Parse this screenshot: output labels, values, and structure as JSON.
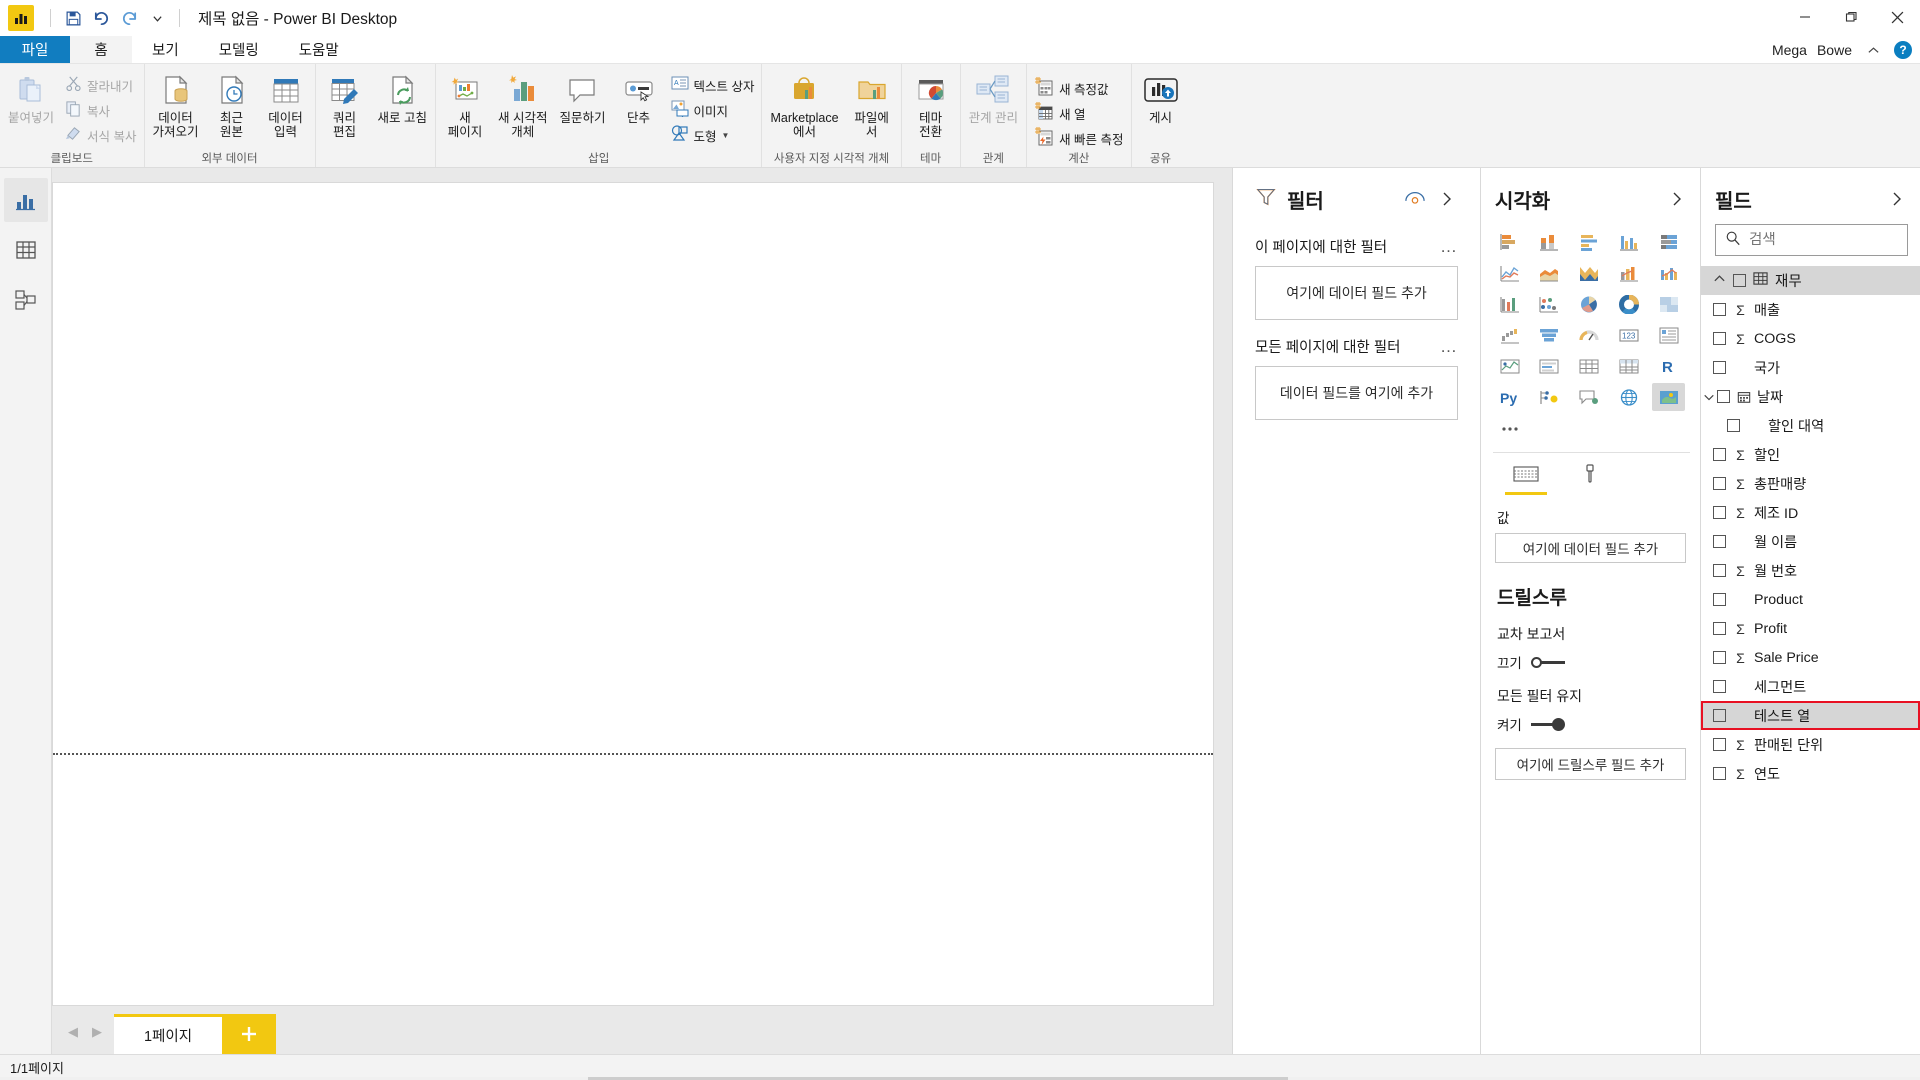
{
  "titlebar": {
    "logo_icon": "power-bi-logo",
    "save_icon": "save-icon",
    "undo_icon": "undo-icon",
    "redo_icon": "redo-icon",
    "qat_more_icon": "chevron-down-icon",
    "document_title": "제목 없음 - Power BI Desktop",
    "minimize_icon": "minimize-icon",
    "restore_icon": "restore-icon",
    "close_icon": "close-icon"
  },
  "tabs": [
    {
      "label": "파일",
      "kind": "file"
    },
    {
      "label": "홈",
      "kind": "active"
    },
    {
      "label": "보기",
      "kind": "normal"
    },
    {
      "label": "모델링",
      "kind": "normal"
    },
    {
      "label": "도움말",
      "kind": "normal"
    }
  ],
  "account": {
    "name_first": "Mega",
    "name_last": "Bowe",
    "collapse_icon": "chevron-up-icon",
    "help_label": "?"
  },
  "ribbon": {
    "groups": [
      {
        "label": "클립보드",
        "big": [
          {
            "label": "붙여넣기",
            "icon": "paste-icon",
            "disabled": true
          }
        ],
        "small": [
          {
            "label": "잘라내기",
            "icon": "cut-icon",
            "disabled": true
          },
          {
            "label": "복사",
            "icon": "copy-icon",
            "disabled": true
          },
          {
            "label": "서식 복사",
            "icon": "format-painter-icon",
            "disabled": true
          }
        ]
      },
      {
        "label": "외부 데이터",
        "big": [
          {
            "label": "데이터\n가져오기",
            "icon": "get-data-icon",
            "caret": true
          },
          {
            "label": "최근\n원본",
            "icon": "recent-sources-icon",
            "caret": true
          },
          {
            "label": "데이터\n입력",
            "icon": "enter-data-icon",
            "caret": false
          },
          {
            "label": "쿼리\n편집",
            "icon": "edit-queries-icon",
            "caret": true
          },
          {
            "label": "새로 고침",
            "icon": "refresh-icon",
            "caret": false
          }
        ]
      },
      {
        "label": "삽입",
        "big": [
          {
            "label": "새\n페이지",
            "icon": "new-page-icon",
            "caret": true
          },
          {
            "label": "새 시각적\n개체",
            "icon": "new-visual-icon",
            "caret": false
          },
          {
            "label": "질문하기",
            "icon": "ask-question-icon",
            "caret": false
          },
          {
            "label": "단추",
            "icon": "button-icon",
            "caret": true
          }
        ],
        "small": [
          {
            "label": "텍스트 상자",
            "icon": "text-box-icon",
            "disabled": false
          },
          {
            "label": "이미지",
            "icon": "image-icon",
            "disabled": false
          },
          {
            "label": "도형",
            "icon": "shapes-icon",
            "disabled": false,
            "caret": true
          }
        ]
      },
      {
        "label": "사용자 지정 시각적 개체",
        "big": [
          {
            "label": "Marketplace\n에서",
            "icon": "marketplace-icon",
            "caret": false
          },
          {
            "label": "파일에\n서",
            "icon": "from-file-icon",
            "caret": false
          }
        ]
      },
      {
        "label": "테마",
        "big": [
          {
            "label": "테마\n전환",
            "icon": "switch-theme-icon",
            "caret": true
          }
        ]
      },
      {
        "label": "관계",
        "big": [
          {
            "label": "관계 관리",
            "icon": "manage-relationships-icon",
            "disabled": true
          }
        ]
      },
      {
        "label": "계산",
        "small": [
          {
            "label": "새 측정값",
            "icon": "new-measure-icon"
          },
          {
            "label": "새 열",
            "icon": "new-column-icon"
          },
          {
            "label": "새 빠른 측정",
            "icon": "new-quick-measure-icon"
          }
        ]
      },
      {
        "label": "공유",
        "big": [
          {
            "label": "게시",
            "icon": "publish-icon",
            "caret": false
          }
        ]
      }
    ]
  },
  "viewbar": {
    "items": [
      {
        "name": "report-view",
        "icon": "report-view-icon",
        "active": true
      },
      {
        "name": "data-view",
        "icon": "data-view-icon",
        "active": false
      },
      {
        "name": "model-view",
        "icon": "model-view-icon",
        "active": false
      }
    ]
  },
  "filters": {
    "title": "필터",
    "eye_icon": "eye-icon",
    "expand_icon": "chevron-right-icon",
    "page_filter_label": "이 페이지에 대한 필터",
    "page_filter_dropzone": "여기에 데이터 필드 추가",
    "all_pages_filter_label": "모든 페이지에 대한 필터",
    "all_pages_dropzone": "데이터 필드를 여기에 추가",
    "more_icon": "ellipsis-icon"
  },
  "visualizations": {
    "title": "시각화",
    "expand_icon": "chevron-right-icon",
    "icons": [
      "stacked-bar-chart",
      "stacked-column-chart",
      "clustered-bar-chart",
      "clustered-column-chart",
      "100-stacked-bar-chart",
      "line-chart",
      "area-chart",
      "stacked-area-chart",
      "line-and-stacked-column-chart",
      "line-and-clustered-column-chart",
      "ribbon-chart",
      "scatter-chart",
      "pie-chart",
      "donut-chart",
      "treemap",
      "waterfall-chart",
      "funnel-chart",
      "gauge-chart",
      "card",
      "multi-row-card",
      "kpi",
      "slicer",
      "table",
      "matrix",
      "r-script-visual",
      "py-visual",
      "key-influencers",
      "qna-visual",
      "arcgis-map",
      "filled-map",
      "more-visuals"
    ],
    "selected_icon_index": 29,
    "fieldwell_tabs": [
      {
        "name": "fields-tab",
        "icon": "fields-well-icon",
        "active": true
      },
      {
        "name": "format-tab",
        "icon": "format-paintbrush-icon",
        "active": false
      }
    ],
    "values_label": "값",
    "values_dropzone": "여기에 데이터 필드 추가",
    "drillthrough_title": "드릴스루",
    "cross_report_label": "교차 보고서",
    "cross_report_toggle_label": "끄기",
    "cross_report_toggle_on": false,
    "keep_filters_label": "모든 필터 유지",
    "keep_filters_toggle_label": "켜기",
    "keep_filters_toggle_on": true,
    "drillthrough_dropzone": "여기에 드릴스루 필드 추가"
  },
  "fields": {
    "title": "필드",
    "expand_icon": "chevron-right-icon",
    "search_icon": "search-icon",
    "search_placeholder": "검색",
    "search_value": "",
    "table": {
      "name": "재무",
      "icon": "table-icon",
      "collapse_icon": "chevron-up-icon",
      "expanded": true
    },
    "items": [
      {
        "label": "매출",
        "sigma": true,
        "checked": false,
        "indent": false,
        "icon": null,
        "chevron": null,
        "highlighted": false
      },
      {
        "label": "COGS",
        "sigma": true,
        "checked": false,
        "indent": false,
        "icon": null,
        "chevron": null,
        "highlighted": false
      },
      {
        "label": "국가",
        "sigma": false,
        "checked": false,
        "indent": false,
        "icon": null,
        "chevron": null,
        "highlighted": false
      },
      {
        "label": "날짜",
        "sigma": false,
        "checked": false,
        "indent": false,
        "icon": "calendar-icon",
        "chevron": "chevron-down-icon",
        "highlighted": false
      },
      {
        "label": "할인 대역",
        "sigma": false,
        "checked": false,
        "indent": true,
        "icon": null,
        "chevron": null,
        "highlighted": false
      },
      {
        "label": "할인",
        "sigma": true,
        "checked": false,
        "indent": false,
        "icon": null,
        "chevron": null,
        "highlighted": false
      },
      {
        "label": "총판매량",
        "sigma": true,
        "checked": false,
        "indent": false,
        "icon": null,
        "chevron": null,
        "highlighted": false
      },
      {
        "label": "제조 ID",
        "sigma": true,
        "checked": false,
        "indent": false,
        "icon": null,
        "chevron": null,
        "highlighted": false
      },
      {
        "label": "월 이름",
        "sigma": false,
        "checked": false,
        "indent": false,
        "icon": null,
        "chevron": null,
        "highlighted": false
      },
      {
        "label": "월 번호",
        "sigma": true,
        "checked": false,
        "indent": false,
        "icon": null,
        "chevron": null,
        "highlighted": false
      },
      {
        "label": "Product",
        "sigma": false,
        "checked": false,
        "indent": false,
        "icon": null,
        "chevron": null,
        "highlighted": false
      },
      {
        "label": "Profit",
        "sigma": true,
        "checked": false,
        "indent": false,
        "icon": null,
        "chevron": null,
        "highlighted": false
      },
      {
        "label": "Sale Price",
        "sigma": true,
        "checked": false,
        "indent": false,
        "icon": null,
        "chevron": null,
        "highlighted": false
      },
      {
        "label": "세그먼트",
        "sigma": false,
        "checked": false,
        "indent": false,
        "icon": null,
        "chevron": null,
        "highlighted": false
      },
      {
        "label": "테스트 열",
        "sigma": false,
        "checked": false,
        "indent": false,
        "icon": null,
        "chevron": null,
        "highlighted": true
      },
      {
        "label": "판매된 단위",
        "sigma": true,
        "checked": false,
        "indent": false,
        "icon": null,
        "chevron": null,
        "highlighted": false
      },
      {
        "label": "연도",
        "sigma": true,
        "checked": false,
        "indent": false,
        "icon": null,
        "chevron": null,
        "highlighted": false
      }
    ]
  },
  "pagebar": {
    "prev_icon": "chevron-left-icon",
    "next_icon": "chevron-right-icon",
    "page_tab_label": "1페이지",
    "add_page_icon": "plus-icon"
  },
  "statusbar": {
    "text": "1/1페이지"
  },
  "colors": {
    "brand_yellow": "#F2C811",
    "file_tab_blue": "#117DC0",
    "highlight_red": "#E81123",
    "selection_gray": "#D6D6D6"
  }
}
